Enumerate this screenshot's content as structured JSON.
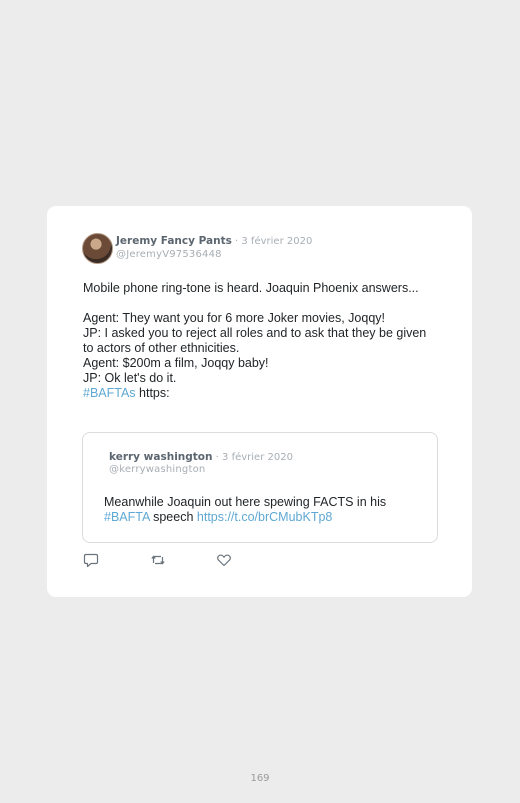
{
  "tweet": {
    "author_name": "Jeremy Fancy Pants",
    "date": " · 3 février 2020",
    "handle": "@JeremyV97536448",
    "lines": [
      "Mobile phone ring-tone is heard. Joaquin Phoenix answers...",
      "",
      "Agent: They want you for 6 more Joker movies, Joqqy!",
      "JP: I asked you to reject all roles and to ask that they be given to actors of other ethnicities.",
      "Agent: $200m a film, Joqqy baby!",
      "JP: Ok let's do it."
    ],
    "hashtag": "#BAFTAs",
    "trailing": " https:"
  },
  "quoted": {
    "author_name": "kerry washington",
    "date": " · 3 février 2020",
    "handle": "@kerrywashington",
    "text_before": "Meanwhile Joaquin out here spewing FACTS in his ",
    "hashtag": "#BAFTA",
    "text_middle": " speech ",
    "link": "https://t.co/brCMubKTp8"
  },
  "actions": {
    "reply_icon": "reply-icon",
    "retweet_icon": "retweet-icon",
    "like_icon": "like-icon"
  },
  "colors": {
    "link": "#5fa8d3",
    "author": "#5c6670",
    "muted": "#a8aeb4",
    "background": "#ececec",
    "card": "#ffffff"
  },
  "page": {
    "number": "169"
  }
}
